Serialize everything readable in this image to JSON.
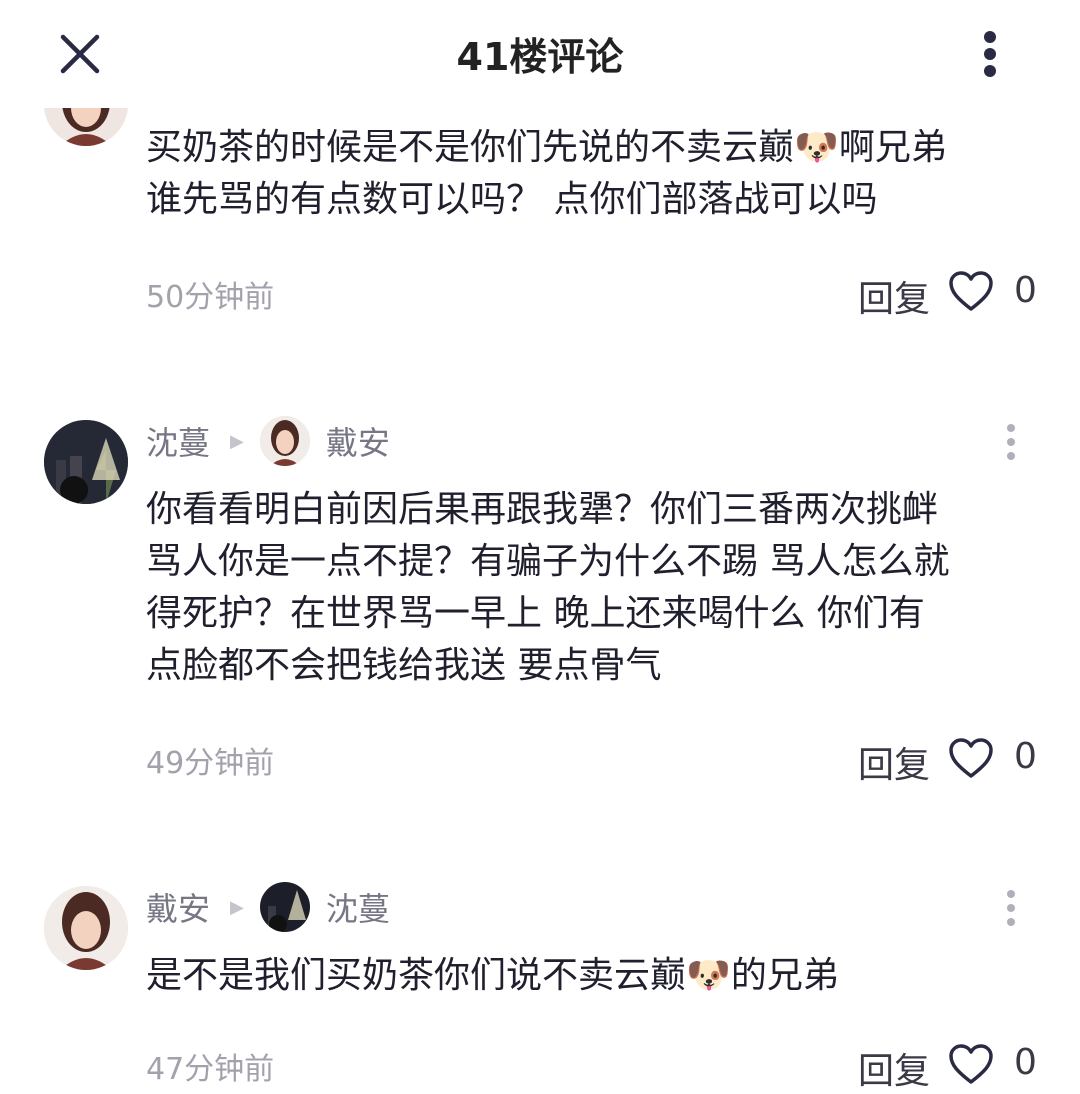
{
  "header": {
    "title": "41楼评论"
  },
  "comments": [
    {
      "text": "买奶茶的时候是不是你们先说的不卖云巅🐶啊兄弟\n谁先骂的有点数可以吗？ 点你们部落战可以吗",
      "time": "50分钟前",
      "reply_label": "回复",
      "likes": "0"
    },
    {
      "author": "沈蔓",
      "reply_to": "戴安",
      "text": "你看看明白前因后果再跟我犟？你们三番两次挑衅\n骂人你是一点不提？有骗子为什么不踢 骂人怎么就\n得死护？在世界骂一早上 晚上还来喝什么 你们有\n点脸都不会把钱给我送 要点骨气",
      "time": "49分钟前",
      "reply_label": "回复",
      "likes": "0"
    },
    {
      "author": "戴安",
      "reply_to": "沈蔓",
      "text": "是不是我们买奶茶你们说不卖云巅🐶的兄弟",
      "time": "47分钟前",
      "reply_label": "回复",
      "likes": "0"
    }
  ]
}
